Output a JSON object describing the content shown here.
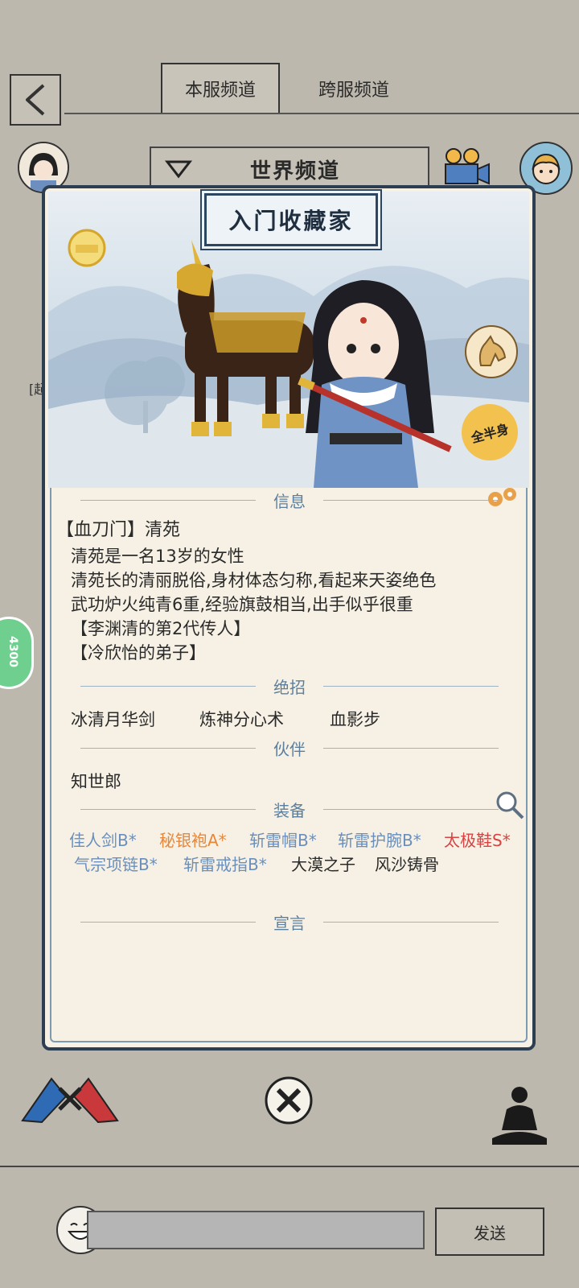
{
  "tabs": {
    "server": "本服频道",
    "cross_server": "跨服频道"
  },
  "channel": {
    "title": "世界频道"
  },
  "popup": {
    "title": "入门收藏家",
    "view_toggle": "全半身",
    "sections": {
      "info": "信息",
      "skills": "绝招",
      "partner": "伙伴",
      "equipment": "装备",
      "declaration": "宣言"
    },
    "character": {
      "name_line": "【血刀门】清苑",
      "desc": [
        "清苑是一名13岁的女性",
        "清苑长的清丽脱俗,身材体态匀称,看起来天姿绝色",
        "武功炉火纯青6重,经验旗鼓相当,出手似乎很重",
        "【李渊清的第2代传人】",
        "【冷欣怡的弟子】"
      ]
    },
    "skills": [
      "冰清月华剑",
      "炼神分心术",
      "血影步"
    ],
    "partner": "知世郎",
    "equipment_row1": [
      {
        "name": "佳人剑B*",
        "color": "#6a8fbd"
      },
      {
        "name": "秘银袍A*",
        "color": "#e8873a"
      },
      {
        "name": "斩雷帽B*",
        "color": "#6a8fbd"
      },
      {
        "name": "斩雷护腕B*",
        "color": "#6a8fbd"
      },
      {
        "name": "太极鞋S*",
        "color": "#d94242"
      }
    ],
    "equipment_row2": [
      {
        "name": "气宗项链B*",
        "color": "#6a8fbd"
      },
      {
        "name": "斩雷戒指B*",
        "color": "#6a8fbd"
      },
      {
        "name": "大漠之子",
        "color": "#2a2a2a"
      },
      {
        "name": "风沙铸骨",
        "color": "#2a2a2a"
      }
    ]
  },
  "side_partial": "[起",
  "side_badge": "4300",
  "chat": {
    "send_label": "发送",
    "input_value": ""
  },
  "icons": {
    "back": "back-arrow-icon",
    "dropdown": "triangle-down-icon",
    "camera": "camera-icon",
    "mount_head": "horse-head-icon",
    "search": "magnifier-icon",
    "pvp": "duel-icon",
    "close": "sword-close-icon",
    "meditate": "meditation-icon",
    "emoji": "laughing-face-icon"
  }
}
